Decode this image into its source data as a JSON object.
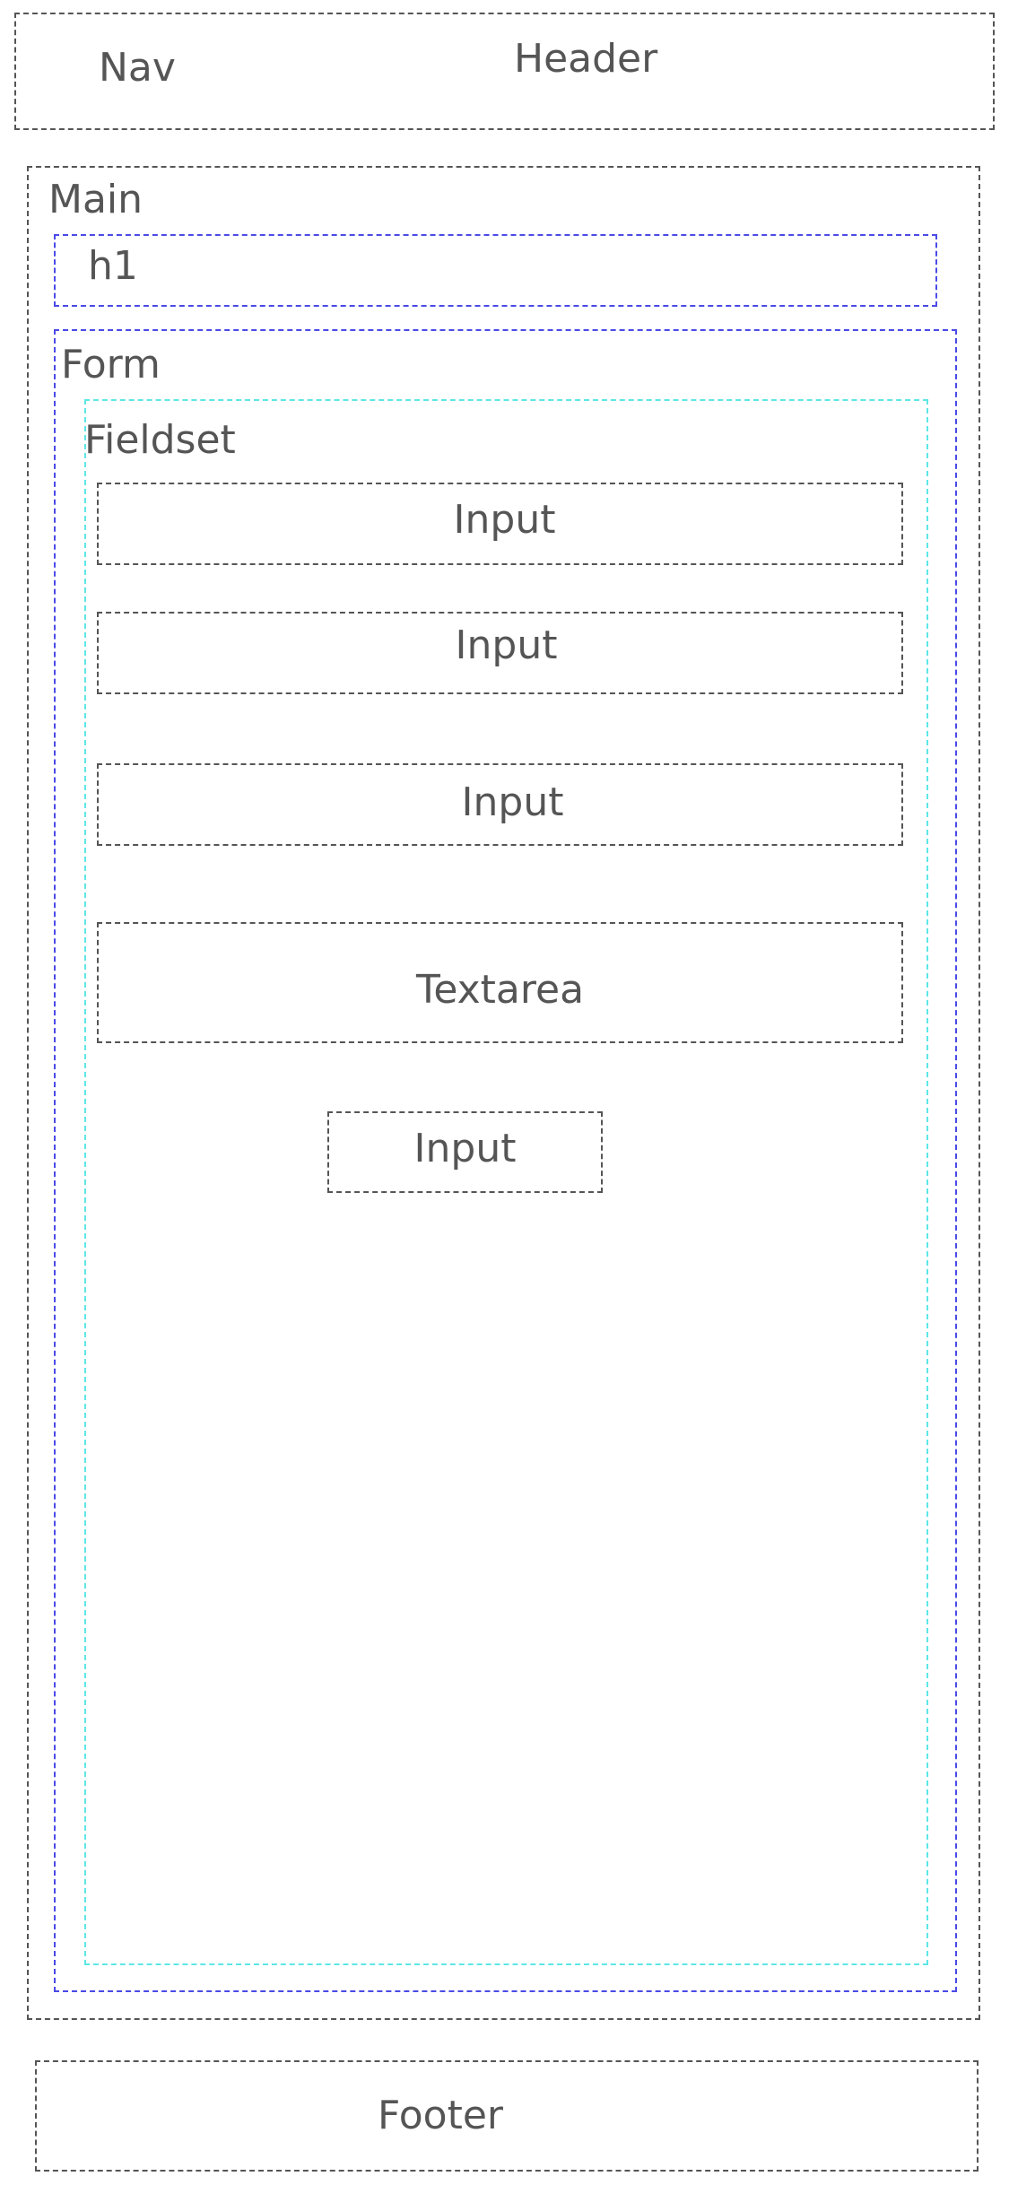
{
  "header": {
    "nav_label": "Nav",
    "header_label": "Header"
  },
  "main": {
    "main_label": "Main",
    "h1_label": "h1",
    "form": {
      "form_label": "Form",
      "fieldset": {
        "fieldset_label": "Fieldset",
        "fields": [
          "Input",
          "Input",
          "Input",
          "Textarea"
        ],
        "submit_label": "Input"
      }
    }
  },
  "footer": {
    "footer_label": "Footer"
  },
  "colors": {
    "outline": "#555555",
    "blue_outline": "#4a4ae6",
    "cyan_outline": "#5ee6e6",
    "text": "#555555"
  }
}
